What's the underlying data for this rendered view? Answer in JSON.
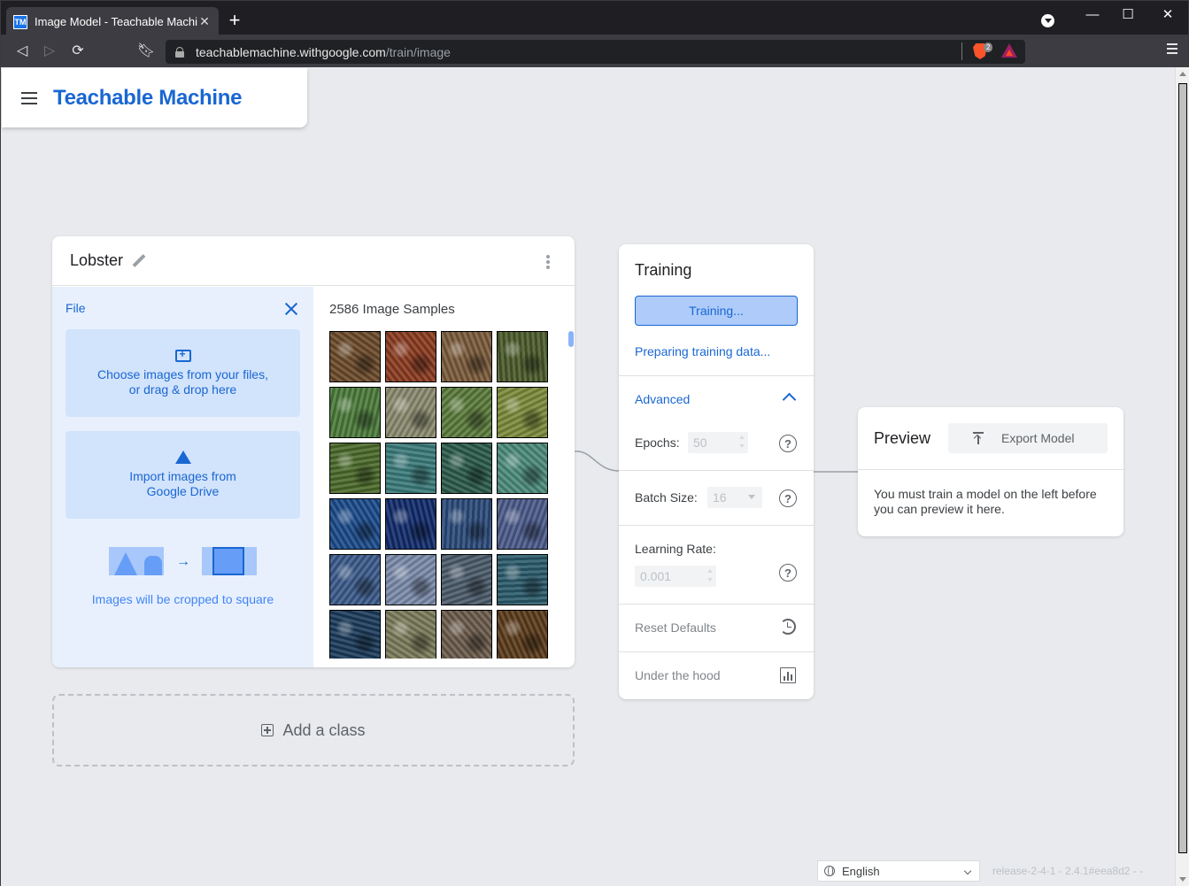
{
  "browser": {
    "tab_title": "Image Model - Teachable Machine",
    "favicon_text": "TM",
    "url_host": "teachablemachine.withgoogle.com",
    "url_path": "/train/image",
    "brave_shield_count": "2"
  },
  "header": {
    "logo": "Teachable Machine"
  },
  "class_card": {
    "name": "Lobster",
    "upload": {
      "title": "File",
      "choose_line1": "Choose images from your files,",
      "choose_line2": "or drag & drop here",
      "drive_line1": "Import images from",
      "drive_line2": "Google Drive",
      "crop_caption": "Images will be cropped to square"
    },
    "samples_title": "2586 Image Samples",
    "thumb_colors": [
      "#6b4a2a",
      "#8a3a1f",
      "#7a5a3a",
      "#4a5a2a",
      "#4a7a3a",
      "#8a8a70",
      "#5a7a3a",
      "#7a8a3a",
      "#4a6a2a",
      "#3a7a7a",
      "#2a5a4a",
      "#4a8a7a",
      "#1a4a8a",
      "#102a6a",
      "#2a4a7a",
      "#4a5a8a",
      "#3a5a8a",
      "#7a8aaa",
      "#4a5a6a",
      "#2a5a6a",
      "#1a3a5a",
      "#7a7a5a",
      "#6a5a4a",
      "#5a3a1a"
    ]
  },
  "add_class": {
    "label": "Add a class"
  },
  "training": {
    "title": "Training",
    "button_label": "Training...",
    "status": "Preparing training data...",
    "advanced_label": "Advanced",
    "epochs_label": "Epochs:",
    "epochs_value": "50",
    "batch_label": "Batch Size:",
    "batch_value": "16",
    "lr_label": "Learning Rate:",
    "lr_value": "0.001",
    "reset_label": "Reset Defaults",
    "hood_label": "Under the hood",
    "help_glyph": "?"
  },
  "preview": {
    "title": "Preview",
    "export_label": "Export Model",
    "message": "You must train a model on the left before you can preview it here."
  },
  "footer": {
    "language": "English",
    "release": "release-2-4-1 - 2.4.1#eea8d2 - -"
  }
}
